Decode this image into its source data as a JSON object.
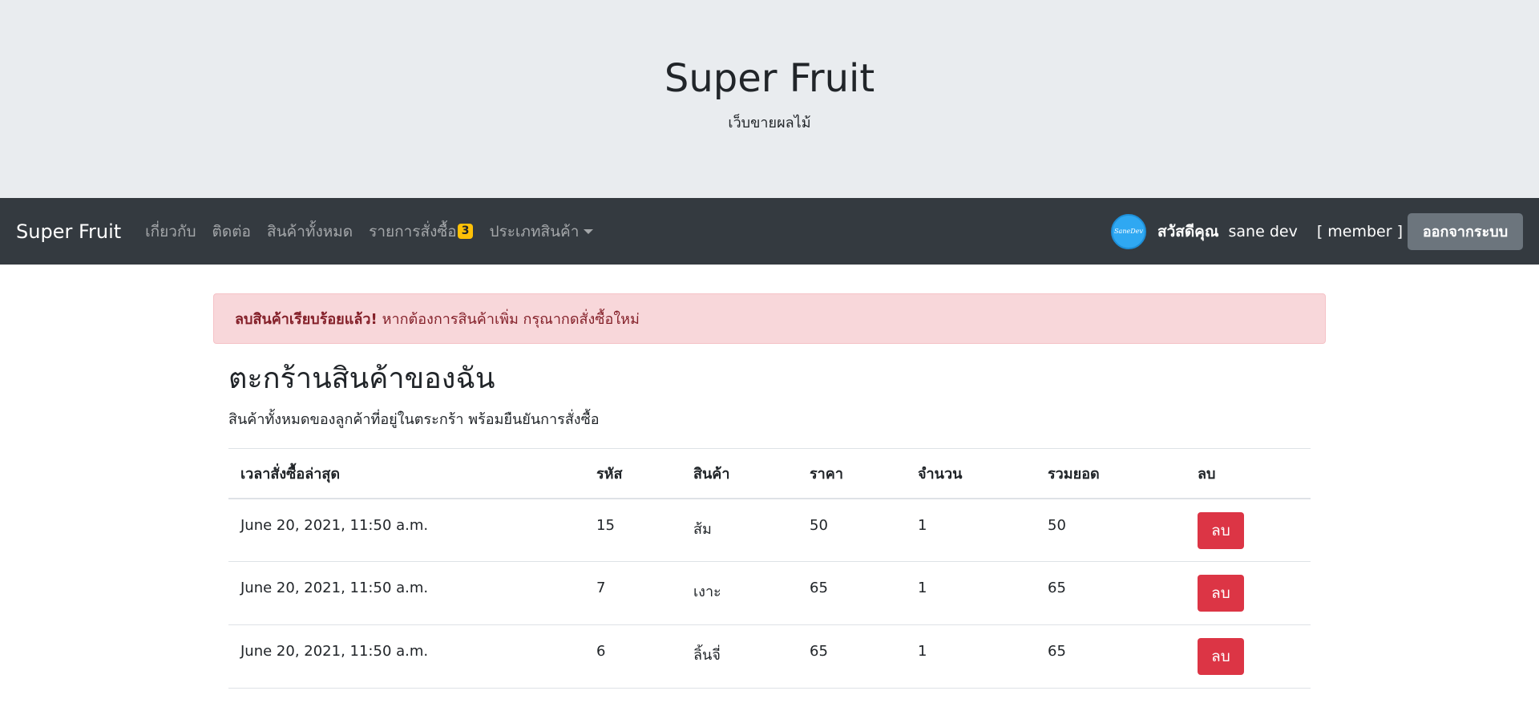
{
  "header": {
    "title": "Super Fruit",
    "subtitle": "เว็บขายผลไม้"
  },
  "navbar": {
    "brand": "Super Fruit",
    "links": [
      {
        "label": "เกี่ยวกับ"
      },
      {
        "label": "ติดต่อ"
      },
      {
        "label": "สินค้าทั้งหมด"
      },
      {
        "label": "รายการสั่งซื้อ",
        "badge": "3"
      },
      {
        "label": "ประเภทสินค้า"
      }
    ],
    "avatar_text": "SaneDev",
    "greeting": "สวัสดีคุณ",
    "username": "sane dev",
    "role": "[ member ]",
    "logout": "ออกจากระบบ"
  },
  "alert": {
    "strong": "ลบสินค้าเรียบร้อยแล้ว!",
    "message": "หากต้องการสินค้าเพิ่ม กรุณากดสั่งซื้อใหม่"
  },
  "cart": {
    "title": "ตะกร้านสินค้าของฉัน",
    "description": "สินค้าทั้งหมดของลูกค้าที่อยู่ในตระกร้า พร้อมยืนยันการสั่งซื้อ",
    "columns": [
      "เวลาสั่งซื้อล่าสุด",
      "รหัส",
      "สินค้า",
      "ราคา",
      "จำนวน",
      "รวมยอด",
      "ลบ"
    ],
    "rows": [
      {
        "time": "June 20, 2021, 11:50 a.m.",
        "id": "15",
        "product": "ส้ม",
        "price": "50",
        "qty": "1",
        "total": "50",
        "delete": "ลบ"
      },
      {
        "time": "June 20, 2021, 11:50 a.m.",
        "id": "7",
        "product": "เงาะ",
        "price": "65",
        "qty": "1",
        "total": "65",
        "delete": "ลบ"
      },
      {
        "time": "June 20, 2021, 11:50 a.m.",
        "id": "6",
        "product": "ลิ้นจี่",
        "price": "65",
        "qty": "1",
        "total": "65",
        "delete": "ลบ"
      }
    ]
  },
  "colors": {
    "navbar_bg": "#343a40",
    "jumbotron_bg": "#e9ecef",
    "alert_bg": "#f8d7da",
    "danger": "#dc3545",
    "badge": "#ffc107",
    "secondary": "#6c757d"
  }
}
